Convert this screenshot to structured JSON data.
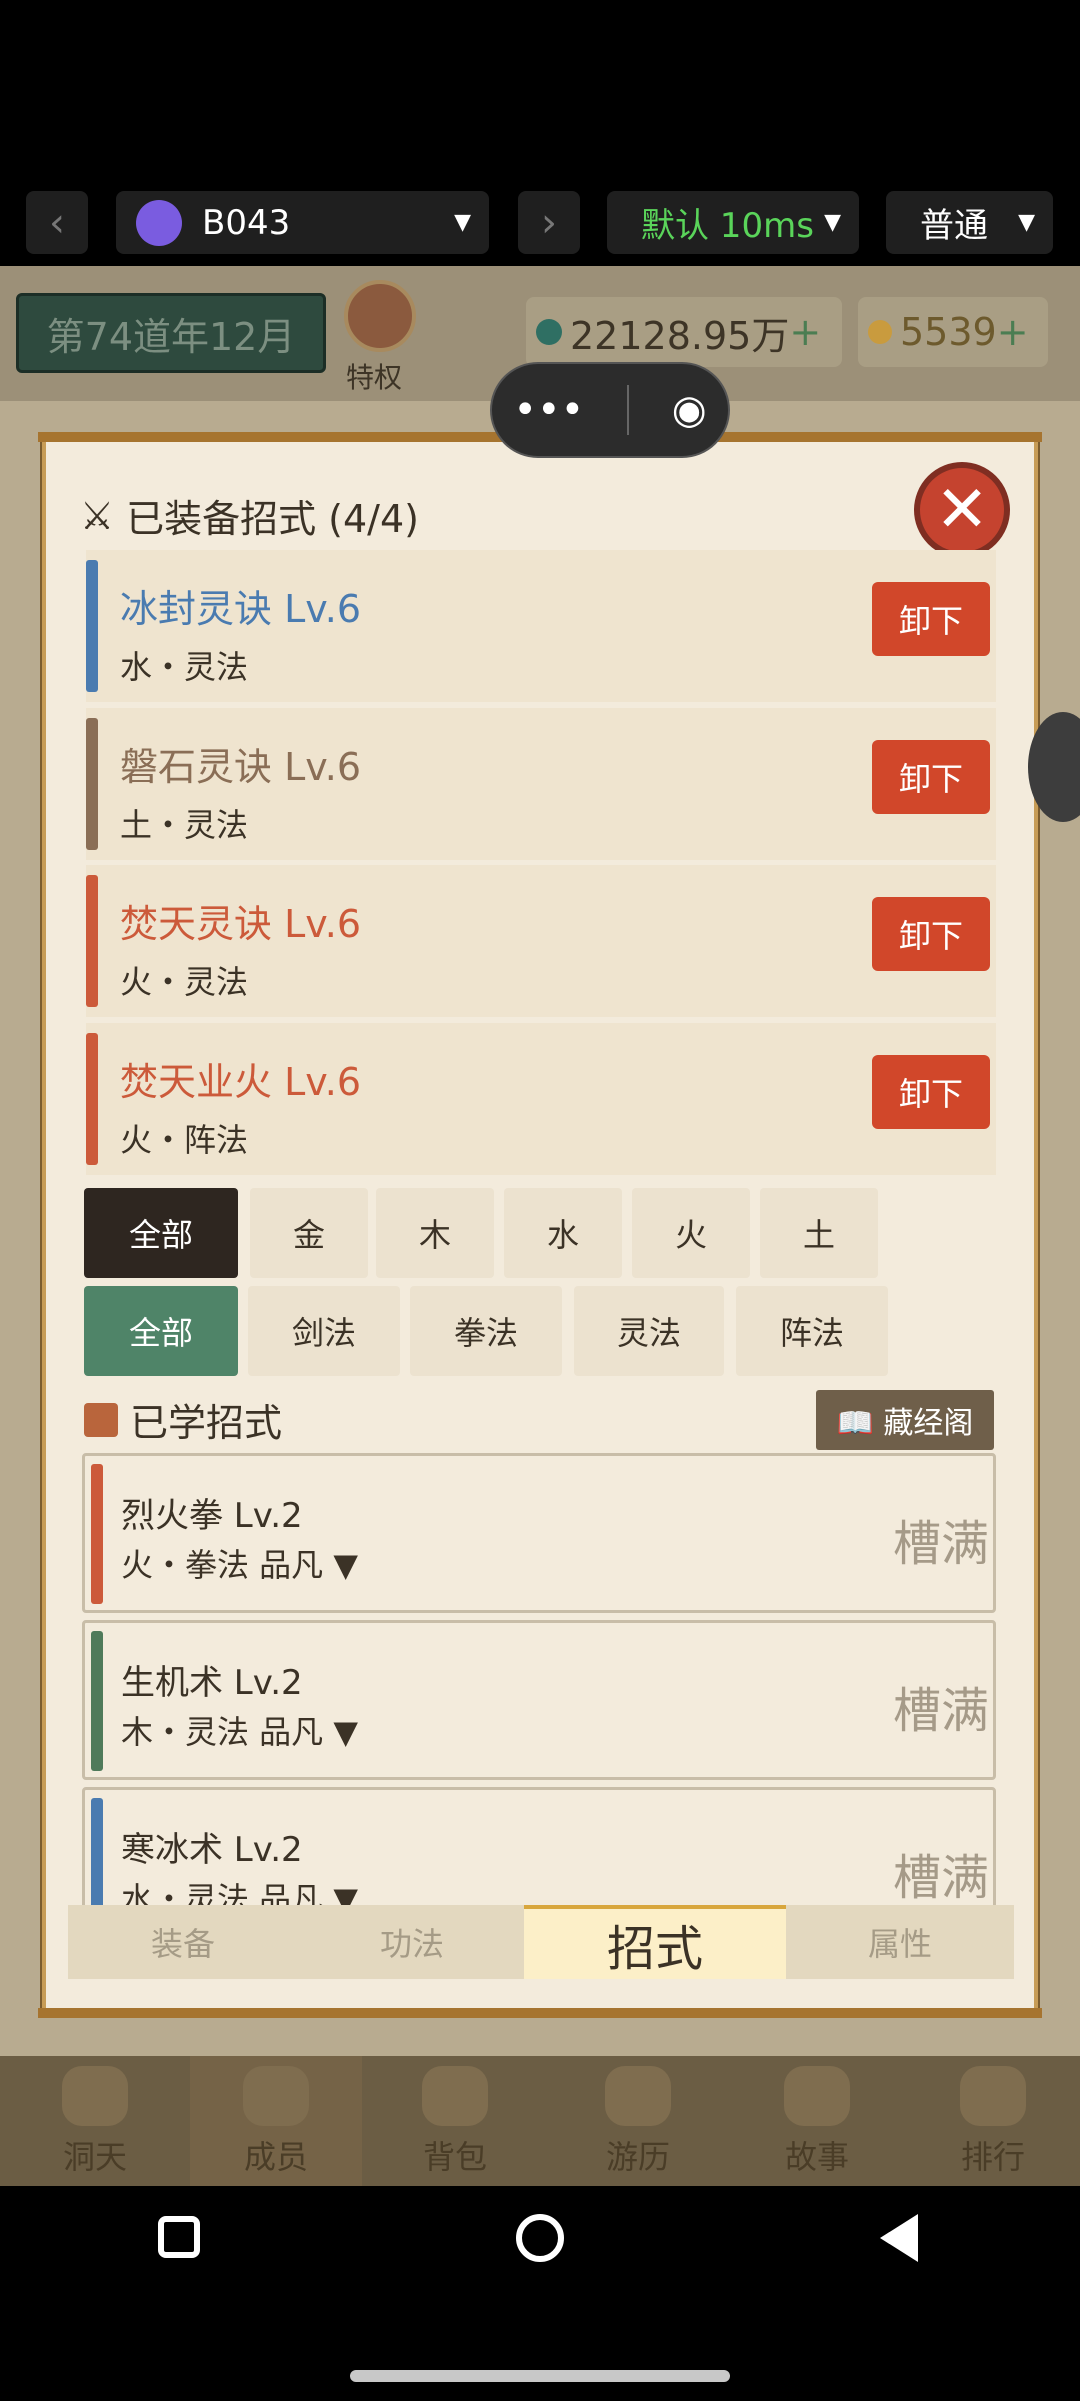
{
  "devbar": {
    "app_name": "B043",
    "latency": "默认 10ms",
    "mode": "普通"
  },
  "game_header": {
    "date": "第74道年12月",
    "privilege_label": "特权",
    "spirit_stones": "22128.95万",
    "gold": "5539",
    "plus": "+"
  },
  "modal": {
    "equipped_title": "已装备招式 (4/4)",
    "close_icon": "close-icon",
    "equipped": [
      {
        "name": "冰封灵诀  Lv.6",
        "sub": "水・灵法",
        "button": "卸下",
        "color": "#4a7bb0"
      },
      {
        "name": "磐石灵诀  Lv.6",
        "sub": "土・灵法",
        "button": "卸下",
        "color": "#8a6e56"
      },
      {
        "name": "焚天灵诀  Lv.6",
        "sub": "火・灵法",
        "button": "卸下",
        "color": "#cc5a3a"
      },
      {
        "name": "焚天业火  Lv.6",
        "sub": "火・阵法",
        "button": "卸下",
        "color": "#cc5a3a"
      }
    ],
    "element_filters": [
      "全部",
      "金",
      "木",
      "水",
      "火",
      "土"
    ],
    "type_filters": [
      "全部",
      "剑法",
      "拳法",
      "灵法",
      "阵法"
    ],
    "learned_title": "已学招式",
    "library_button": "📖 藏经阁",
    "learned": [
      {
        "name": "烈火拳  Lv.2",
        "sub": "火・拳法  品凡",
        "status": "槽满",
        "color": "#cc5a3a"
      },
      {
        "name": "生机术  Lv.2",
        "sub": "木・灵法  品凡",
        "status": "槽满",
        "color": "#4f7a5a"
      },
      {
        "name": "寒冰术  Lv.2",
        "sub": "水・灵法  品凡",
        "status": "槽满",
        "color": "#4a7bb0"
      }
    ],
    "tabs": [
      "装备",
      "功法",
      "招式",
      "属性"
    ],
    "active_tab": "招式"
  },
  "bottom_nav": [
    "洞天",
    "成员",
    "背包",
    "游历",
    "故事",
    "排行"
  ]
}
